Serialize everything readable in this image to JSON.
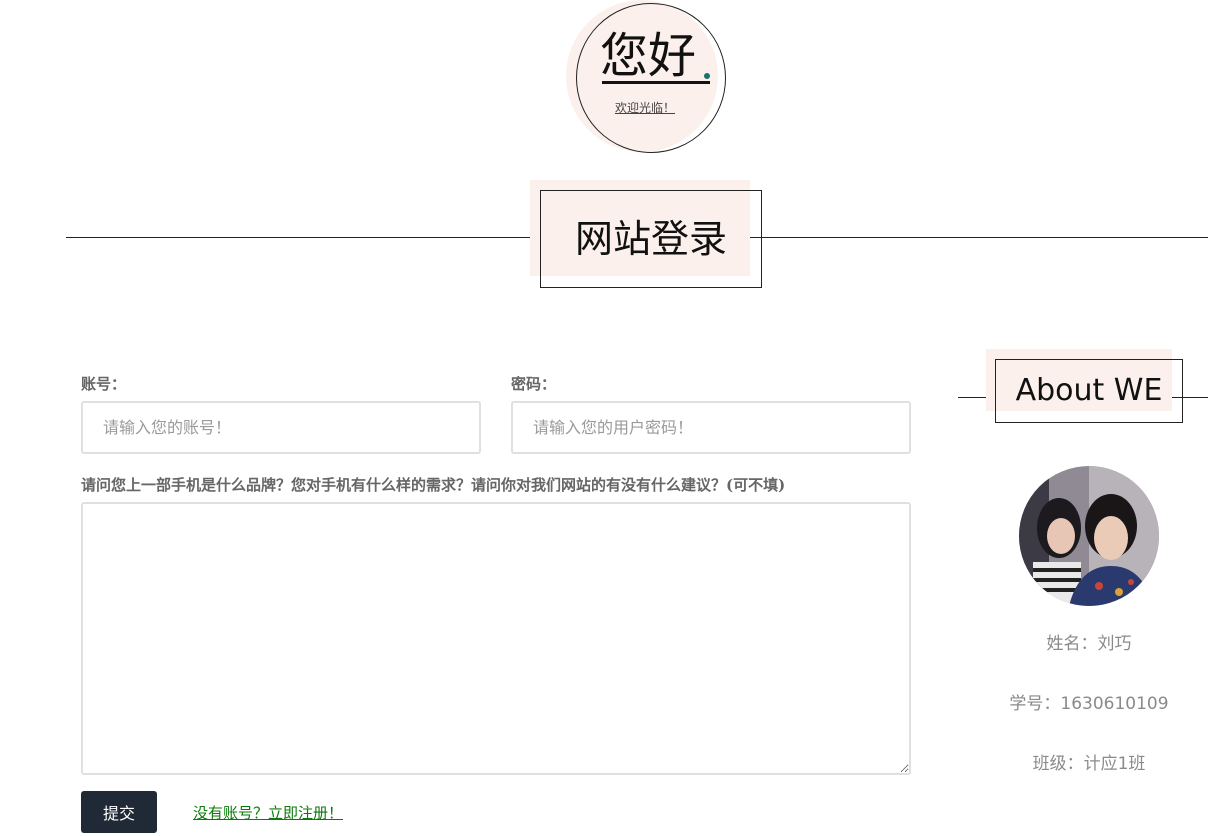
{
  "hero": {
    "title": "您好",
    "subtitle": "欢迎光临！"
  },
  "section": {
    "title": "网站登录"
  },
  "form": {
    "account_label": "账号：",
    "account_placeholder": "请输入您的账号！",
    "password_label": "密码：",
    "password_placeholder": "请输入您的用户密码！",
    "question_label": "请问您上一部手机是什么品牌？您对手机有什么样的需求？请问你对我们网站的有没有什么建议？(可不填)",
    "submit_label": "提交",
    "register_link": "没有账号？立即注册！"
  },
  "about": {
    "title": "About WE",
    "name": "姓名：刘巧",
    "student_id": "学号：1630610109",
    "class": "班级：计应1班"
  },
  "colors": {
    "accent_shade": "#fbf0eb",
    "button": "#1f2a36",
    "link": "#0a7a0a"
  }
}
